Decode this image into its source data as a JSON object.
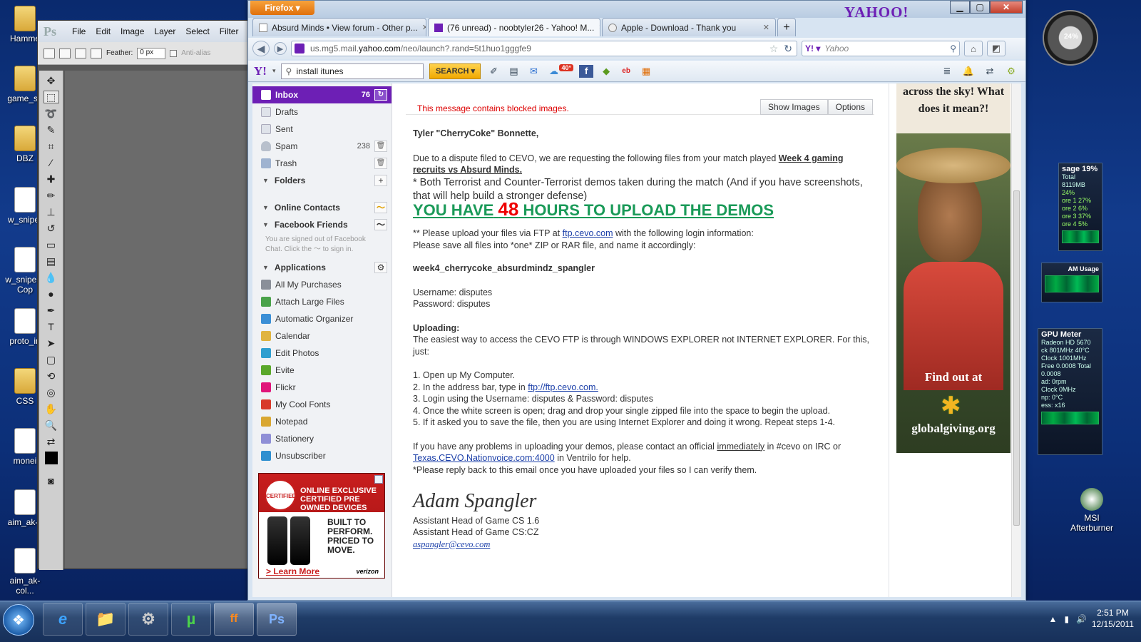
{
  "desktop": {
    "icons": [
      {
        "label": "Hamme",
        "kind": "folder"
      },
      {
        "label": "game_sh",
        "kind": "folder"
      },
      {
        "label": "DBZ",
        "kind": "folder"
      },
      {
        "label": "w_sniper",
        "kind": "file"
      },
      {
        "label": "w_sniper - Cop",
        "kind": "file"
      },
      {
        "label": "proto_in",
        "kind": "file"
      },
      {
        "label": "CSS",
        "kind": "folder"
      },
      {
        "label": "monei",
        "kind": "file"
      },
      {
        "label": "aim_ak-c",
        "kind": "file"
      },
      {
        "label": "aim_ak-col...",
        "kind": "file"
      }
    ],
    "right_icon": {
      "label": "MSI Afterburner"
    }
  },
  "photoshop": {
    "logo": "Ps",
    "menu": [
      "File",
      "Edit",
      "Image",
      "Layer",
      "Select",
      "Filter"
    ],
    "feather_label": "Feather:",
    "feather_value": "0 px",
    "antialias_label": "Anti-alias"
  },
  "firefox": {
    "button_label": "Firefox",
    "brand": "YAHOO!",
    "tabs": [
      {
        "label": "Absurd Minds • View forum - Other p...",
        "active": false
      },
      {
        "label": "(76 unread) - noobtyler26 - Yahoo! M...",
        "active": true
      },
      {
        "label": "Apple - Download - Thank you",
        "active": false
      }
    ],
    "url_prefix": "us.mg5.mail.",
    "url_domain": "yahoo.com",
    "url_suffix": "/neo/launch?.rand=5t1huo1gggfe9",
    "search_placeholder": "Yahoo"
  },
  "yahoo_toolbar": {
    "logo": "Y!",
    "search_value": "install itunes",
    "search_button": "SEARCH",
    "weather": "40°"
  },
  "mail_nav": {
    "inbox": {
      "label": "Inbox",
      "count": "76"
    },
    "drafts": "Drafts",
    "sent": "Sent",
    "spam": {
      "label": "Spam",
      "count": "238"
    },
    "trash": "Trash",
    "folders": "Folders",
    "online_contacts": "Online Contacts",
    "facebook_friends": "Facebook Friends",
    "facebook_note": "You are signed out of Facebook Chat. Click the",
    "facebook_note2": "to sign in.",
    "applications": "Applications",
    "apps": [
      {
        "label": "All My Purchases",
        "color": "#8a8f99"
      },
      {
        "label": "Attach Large Files",
        "color": "#4aa24a"
      },
      {
        "label": "Automatic Organizer",
        "color": "#3b8fd6"
      },
      {
        "label": "Calendar",
        "color": "#e0b440"
      },
      {
        "label": "Edit Photos",
        "color": "#2f9fd0"
      },
      {
        "label": "Evite",
        "color": "#5aa82a"
      },
      {
        "label": "Flickr",
        "color": "#e0157a"
      },
      {
        "label": "My Cool Fonts",
        "color": "#d83a2a"
      },
      {
        "label": "Notepad",
        "color": "#d9a732"
      },
      {
        "label": "Stationery",
        "color": "#8f8fd6"
      },
      {
        "label": "Unsubscriber",
        "color": "#2f8fd0"
      }
    ]
  },
  "left_ad": {
    "seal": "CERTIFIED",
    "headline": "ONLINE EXCLUSIVE CERTIFIED PRE OWNED DEVICES",
    "slogan": "BUILT TO PERFORM. PRICED TO MOVE.",
    "link": "> Learn More",
    "brand": "verizon"
  },
  "message": {
    "blocked_notice": "This message contains blocked images.",
    "show_images": "Show Images",
    "options": "Options",
    "greeting": "Tyler \"CherryCoke\" Bonnette,",
    "intro": "Due to a dispute filed to CEVO, we are requesting the following files from your match played",
    "match_link": "Week 4 gaming recruits vs Absurd Minds.",
    "demos_note": "* Both Terrorist and Counter-Terrorist demos taken during the match (And if you have screenshots, that will help build a stronger defense)",
    "headline_pre": "YOU HAVE",
    "headline_num": "48",
    "headline_post": "HOURS TO UPLOAD THE DEMOS",
    "ftp_line_pre": "** Please upload your files via FTP at",
    "ftp_link": "ftp.cevo.com",
    "ftp_line_post": "with the following login information:",
    "zip_line": "Please save all files into *one* ZIP or RAR file, and name it accordingly:",
    "filename": "week4_cherrycoke_absurdmindz_spangler",
    "username": "Username: disputes",
    "password": "Password: disputes",
    "uploading_title": "Uploading:",
    "uploading_desc": "The easiest way to access the CEVO FTP is through WINDOWS EXPLORER not INTERNET EXPLORER. For this, just:",
    "step1": "1. Open up My Computer.",
    "step2_pre": "2. In the address bar, type in",
    "step2_link": "ftp://ftp.cevo.com.",
    "step3": "3. Login using the Username: disputes & Password: disputes",
    "step4": "4. Once the white screen is open; drag and drop your single zipped file into the space to begin the upload.",
    "step5": "5. If it asked you to save the file, then you are using Internet Explorer and doing it wrong. Repeat steps 1-4.",
    "problems_pre": "If you have any problems in uploading your demos, please contact an official",
    "problems_link": "immediately",
    "problems_mid": "in #cevo on IRC or",
    "vent_link": "Texas.CEVO.Nationvoice.com:4000",
    "problems_post": "in Ventrilo for help.",
    "reply_note": "*Please reply back to this email once you have uploaded your files so I can verify them.",
    "signature": "Adam Spangler",
    "title1": "Assistant Head of Game CS 1.6",
    "title2": "Assistant Head of Game CS:CZ",
    "email": "aspangler@cevo.com"
  },
  "right_ad": {
    "top": "across the sky! What does it mean?!",
    "find": "Find out at",
    "url": "globalgiving.org"
  },
  "gadgets": {
    "cpu_title": "sage 19%",
    "cpu_lines": [
      "Total 8119MB",
      "24%",
      "ore 1 27%",
      "ore 2 6%",
      "ore 3 37%",
      "ore 4 5%"
    ],
    "ram_title": "AM Usage",
    "gpu_title": "GPU Meter",
    "gpu_lines": [
      "Radeon HD 5670",
      "ck 801MHz 40°C",
      "Clock 1001MHz",
      "Free 0.0008 Total 0.0008",
      "ad: 0rpm",
      "Clock 0MHz",
      "np: 0°C",
      "ess: x16"
    ],
    "gauge_label": "24%"
  },
  "taskbar": {
    "apps": [
      "e",
      "📁",
      "⚙",
      "µ",
      "ff",
      "Ps"
    ],
    "time": "2:51 PM",
    "date": "12/15/2011"
  }
}
